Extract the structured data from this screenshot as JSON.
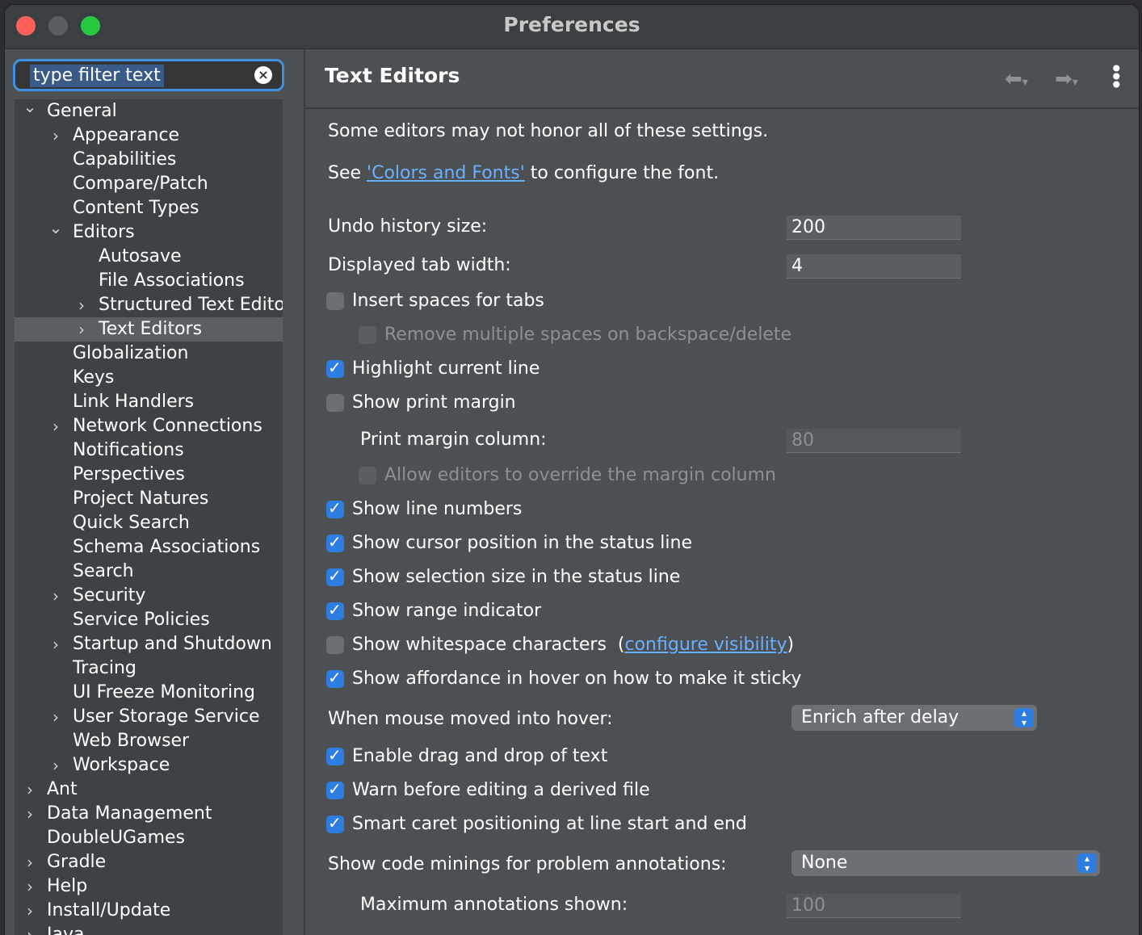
{
  "window": {
    "title": "Preferences"
  },
  "sidebar": {
    "filter": {
      "value": "type filter text"
    },
    "tree": [
      {
        "label": "General",
        "expander": "v"
      },
      {
        "label": "Appearance",
        "expander": ">"
      },
      {
        "label": "Capabilities",
        "expander": ""
      },
      {
        "label": "Compare/Patch",
        "expander": ""
      },
      {
        "label": "Content Types",
        "expander": ""
      },
      {
        "label": "Editors",
        "expander": "v"
      },
      {
        "label": "Autosave",
        "expander": ""
      },
      {
        "label": "File Associations",
        "expander": ""
      },
      {
        "label": "Structured Text Editor",
        "expander": ">"
      },
      {
        "label": "Text Editors",
        "expander": ">"
      },
      {
        "label": "Globalization",
        "expander": ""
      },
      {
        "label": "Keys",
        "expander": ""
      },
      {
        "label": "Link Handlers",
        "expander": ""
      },
      {
        "label": "Network Connections",
        "expander": ">"
      },
      {
        "label": "Notifications",
        "expander": ""
      },
      {
        "label": "Perspectives",
        "expander": ""
      },
      {
        "label": "Project Natures",
        "expander": ""
      },
      {
        "label": "Quick Search",
        "expander": ""
      },
      {
        "label": "Schema Associations",
        "expander": ""
      },
      {
        "label": "Search",
        "expander": ""
      },
      {
        "label": "Security",
        "expander": ">"
      },
      {
        "label": "Service Policies",
        "expander": ""
      },
      {
        "label": "Startup and Shutdown",
        "expander": ">"
      },
      {
        "label": "Tracing",
        "expander": ""
      },
      {
        "label": "UI Freeze Monitoring",
        "expander": ""
      },
      {
        "label": "User Storage Service",
        "expander": ">"
      },
      {
        "label": "Web Browser",
        "expander": ""
      },
      {
        "label": "Workspace",
        "expander": ">"
      },
      {
        "label": "Ant",
        "expander": ">"
      },
      {
        "label": "Data Management",
        "expander": ">"
      },
      {
        "label": "DoubleUGames",
        "expander": ""
      },
      {
        "label": "Gradle",
        "expander": ">"
      },
      {
        "label": "Help",
        "expander": ">"
      },
      {
        "label": "Install/Update",
        "expander": ">"
      },
      {
        "label": "Java",
        "expander": ">"
      }
    ],
    "selected": "Text Editors"
  },
  "page": {
    "title": "Text Editors",
    "intro": "Some editors may not honor all of these settings.",
    "see_prefix": "See ",
    "see_link": "'Colors and Fonts'",
    "see_suffix": " to configure the font.",
    "undo_label": "Undo history size:",
    "undo_value": "200",
    "tab_label": "Displayed tab width:",
    "tab_value": "4",
    "insert_spaces": "Insert spaces for tabs",
    "remove_spaces": "Remove multiple spaces on backspace/delete",
    "highlight_line": "Highlight current line",
    "print_margin": "Show print margin",
    "print_margin_col_label": "Print margin column:",
    "print_margin_col_value": "80",
    "allow_override": "Allow editors to override the margin column",
    "line_numbers": "Show line numbers",
    "cursor_pos": "Show cursor position in the status line",
    "selection_size": "Show selection size in the status line",
    "range_indicator": "Show range indicator",
    "whitespace": "Show whitespace characters",
    "whitespace_link": "configure visibility",
    "affordance": "Show affordance in hover on how to make it sticky",
    "hover_label": "When mouse moved into hover:",
    "hover_value": "Enrich after delay",
    "drag_drop": "Enable drag and drop of text",
    "warn_derived": "Warn before editing a derived file",
    "smart_caret": "Smart caret positioning at line start and end",
    "code_minings_label": "Show code minings for problem annotations:",
    "code_minings_value": "None",
    "max_annotations_label": "Maximum annotations shown:",
    "max_annotations_value": "100"
  },
  "colors": {
    "accent": "#2f7de0",
    "link": "#6ab0ff",
    "panel": "#4d5053",
    "tree_bg": "#3f4245"
  }
}
